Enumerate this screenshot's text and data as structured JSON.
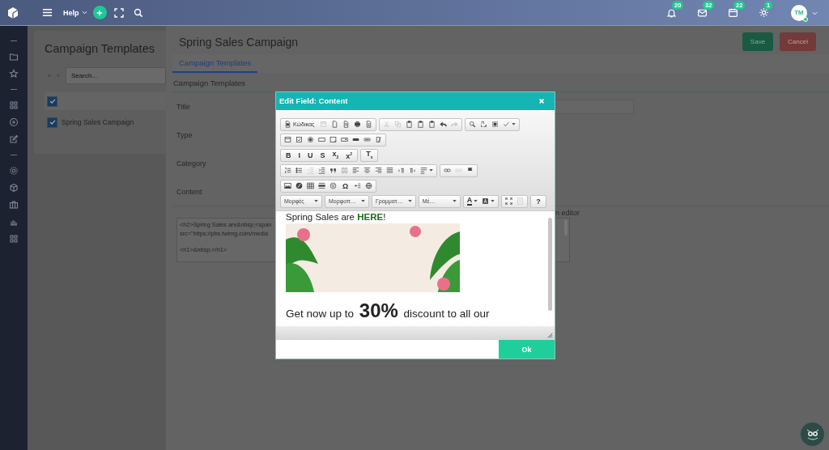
{
  "topbar": {
    "help_menu": "Help",
    "notifications": [
      {
        "count": "20"
      },
      {
        "count": "32"
      },
      {
        "count": "22"
      },
      {
        "count": "1"
      }
    ],
    "avatar": {
      "initials": "TM",
      "online": true
    }
  },
  "list_panel": {
    "title": "Campaign Templates",
    "search": {
      "placeholder": "Search..."
    },
    "header_checked": true,
    "rows": [
      {
        "name": "Spring Sales Campaign",
        "checked": true
      }
    ]
  },
  "record": {
    "title": "Spring Sales Campaign",
    "buttons": [
      {
        "label": "Save",
        "kind": "save"
      },
      {
        "label": "Cancel",
        "kind": "cancel"
      }
    ],
    "tabs": [
      {
        "label": "Campaign Templates",
        "selected": true
      }
    ],
    "section": "Campaign Templates",
    "fields": [
      {
        "label": "Title",
        "kind": "input"
      },
      {
        "label": "Type",
        "kind": "plain"
      },
      {
        "label": "Category",
        "kind": "plain"
      },
      {
        "label": "Content",
        "kind": "plain"
      }
    ],
    "editor_toggle": "n editor",
    "source_paragraphs": [
      [
        "<h2>Spring Sales are&nbsp;<span",
        "src=\"https://pbs.twimg.com/media"
      ],
      [
        "<h1>&nbsp;</h1>"
      ]
    ]
  },
  "modal": {
    "title": "Edit Field: Content",
    "toolbar": [
      [
        [
          {
            "kind": "source",
            "label": "Κώδικας"
          },
          {
            "kind": "icon",
            "disabled": true
          },
          {
            "kind": "icon",
            "disabled": false
          },
          {
            "kind": "icon",
            "disabled": false
          },
          {
            "kind": "icon",
            "disabled": false
          },
          {
            "kind": "icon",
            "disabled": false
          }
        ],
        [
          {
            "kind": "icon",
            "disabled": true
          },
          {
            "kind": "icon",
            "disabled": true
          },
          {
            "kind": "icon",
            "disabled": false
          },
          {
            "kind": "icon",
            "disabled": false
          },
          {
            "kind": "icon",
            "disabled": false
          },
          {
            "kind": "icon",
            "disabled": false
          },
          {
            "kind": "icon",
            "disabled": true
          }
        ],
        [
          {
            "kind": "icon",
            "disabled": false
          },
          {
            "kind": "icon",
            "disabled": false
          },
          {
            "kind": "icon",
            "disabled": false
          },
          {
            "kind": "dropdown",
            "disabled": false
          }
        ]
      ],
      [
        [
          {
            "kind": "icon",
            "disabled": false
          },
          {
            "kind": "icon",
            "disabled": false
          },
          {
            "kind": "icon",
            "disabled": false
          },
          {
            "kind": "icon",
            "disabled": false
          },
          {
            "kind": "icon",
            "disabled": false
          },
          {
            "kind": "icon",
            "disabled": false
          },
          {
            "kind": "icon",
            "disabled": false
          },
          {
            "kind": "icon",
            "disabled": false
          },
          {
            "kind": "icon",
            "disabled": false
          }
        ]
      ],
      [
        [
          {
            "kind": "text",
            "label": "B"
          },
          {
            "kind": "text",
            "label": "I"
          },
          {
            "kind": "text",
            "label": "U"
          },
          {
            "kind": "text",
            "label": "S"
          },
          {
            "kind": "text",
            "label": "x$_{2}$"
          },
          {
            "kind": "text",
            "label": "x$^{2}$"
          }
        ],
        [
          {
            "kind": "text",
            "label": "T$_{x}$"
          }
        ]
      ],
      [
        [
          {
            "kind": "icon",
            "disabled": false
          },
          {
            "kind": "icon",
            "disabled": false
          },
          {
            "kind": "icon",
            "disabled": true
          },
          {
            "kind": "icon",
            "disabled": false
          },
          {
            "kind": "icon",
            "disabled": false
          },
          {
            "kind": "icon",
            "disabled": false
          },
          {
            "kind": "icon",
            "disabled": false
          },
          {
            "kind": "icon",
            "disabled": false
          },
          {
            "kind": "icon",
            "disabled": false
          },
          {
            "kind": "icon",
            "disabled": false
          },
          {
            "kind": "icon",
            "disabled": false
          },
          {
            "kind": "icon",
            "disabled": false
          },
          {
            "kind": "dropdown",
            "disabled": false
          }
        ],
        [
          {
            "kind": "icon",
            "disabled": false
          },
          {
            "kind": "icon",
            "disabled": true
          },
          {
            "kind": "icon",
            "disabled": false
          }
        ]
      ],
      [
        [
          {
            "kind": "icon",
            "disabled": false
          },
          {
            "kind": "icon",
            "disabled": false
          },
          {
            "kind": "icon",
            "disabled": false
          },
          {
            "kind": "icon",
            "disabled": false
          },
          {
            "kind": "icon",
            "disabled": false
          },
          {
            "kind": "text",
            "label": "Ω"
          },
          {
            "kind": "icon",
            "disabled": false
          },
          {
            "kind": "icon",
            "disabled": false
          }
        ]
      ],
      [
        [
          {
            "kind": "combo",
            "label": "Μορφές"
          }
        ],
        [
          {
            "kind": "combo",
            "label": "Μορφοπ…"
          }
        ],
        [
          {
            "kind": "combo",
            "label": "Γραμματ…"
          }
        ],
        [
          {
            "kind": "combo",
            "label": "Μέ…"
          }
        ],
        [
          {
            "kind": "color",
            "label": "A"
          },
          {
            "kind": "dropdown",
            "disabled": false
          }
        ],
        [
          {
            "kind": "icon",
            "disabled": false
          },
          {
            "kind": "icon",
            "disabled": true
          }
        ],
        [
          {
            "kind": "text",
            "label": "?"
          }
        ]
      ]
    ],
    "content": {
      "headline": "Spring Sales are **HERE**!",
      "paragraph": "Get now up to **30%** discount to all our"
    },
    "ok": "Ok"
  }
}
